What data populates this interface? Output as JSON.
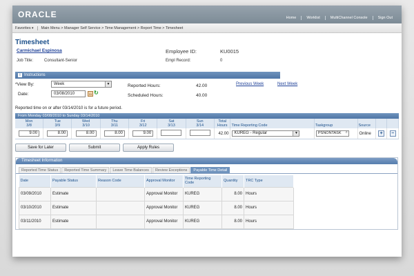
{
  "brand": "ORACLE",
  "top_links": [
    "Home",
    "Worklist",
    "MultiChannel Console",
    "Sign Out"
  ],
  "menu": {
    "favorites": "Favorites",
    "breadcrumb": "Main Menu > Manager Self Service > Time Management > Report Time > Timesheet"
  },
  "page": {
    "title": "Timesheet",
    "employee_name": "Carmichael Espinosa",
    "job_title_label": "Job Title:",
    "job_title": "Consultant-Senior",
    "employee_id_label": "Employee ID:",
    "employee_id": "KU0015",
    "empl_record_label": "Empl Record:",
    "empl_record": "0"
  },
  "instructions_label": "Instructions",
  "controls": {
    "view_by_label": "*View By:",
    "view_by_value": "Week",
    "date_label": "Date:",
    "date_value": "03/08/2010",
    "reported_hours_label": "Reported Hours:",
    "reported_hours": "42.00",
    "scheduled_hours_label": "Scheduled Hours:",
    "scheduled_hours": "40.00",
    "previous_week": "Previous Week",
    "next_week": "Next Week"
  },
  "future_message": "Reported time on or after 03/14/2010 is for a future period.",
  "grid": {
    "period": "From Monday 03/08/2010 to Sunday 03/14/2010",
    "days": [
      {
        "day": "Mon",
        "date": "3/8",
        "hours": "9.00"
      },
      {
        "day": "Tue",
        "date": "3/9",
        "hours": "8.00"
      },
      {
        "day": "Wed",
        "date": "3/10",
        "hours": "8.00"
      },
      {
        "day": "Thu",
        "date": "3/11",
        "hours": "8.00"
      },
      {
        "day": "Fri",
        "date": "3/12",
        "hours": "9.00"
      },
      {
        "day": "Sat",
        "date": "3/13",
        "hours": ""
      },
      {
        "day": "Sun",
        "date": "3/14",
        "hours": ""
      }
    ],
    "total_label": "Total",
    "hours_label": "Hours",
    "trc_label": "Time Reporting Code",
    "taskgroup_label": "Taskgroup",
    "source_label": "Source",
    "total": "42.00",
    "trc_value": "KUREG - Regular",
    "taskgroup_value": "PSNONTASK",
    "source_value": "Online",
    "add_symbol": "+",
    "remove_symbol": "−"
  },
  "buttons": {
    "save_later": "Save for Later",
    "submit": "Submit",
    "apply_rules": "Apply Rules"
  },
  "info_panel": {
    "title": "Timesheet Information",
    "tabs": [
      "Reported Time Status",
      "Reported Time Summary",
      "Leave Time Balances",
      "Review Exceptions",
      "Payable Time Detail"
    ],
    "active_tab": "Payable Time Detail",
    "columns": [
      "Date",
      "Payable Status",
      "Reason Code",
      "Approval Monitor",
      "Time Reporting Code",
      "Quantity",
      "TRC Type"
    ],
    "rows": [
      {
        "date": "03/09/2010",
        "status": "Estimate",
        "reason": "",
        "approval": "Approval Monitor",
        "trc": "KUREG",
        "quantity": "8.00",
        "trc_type": "Hours"
      },
      {
        "date": "03/10/2010",
        "status": "Estimate",
        "reason": "",
        "approval": "Approval Monitor",
        "trc": "KUREG",
        "quantity": "8.00",
        "trc_type": "Hours"
      },
      {
        "date": "03/11/2010",
        "status": "Estimate",
        "reason": "",
        "approval": "Approval Monitor",
        "trc": "KUREG",
        "quantity": "8.00",
        "trc_type": "Hours"
      }
    ]
  },
  "colors": {
    "accent": "#4f76a6",
    "link": "#1d3f97",
    "title": "#1b4f8a"
  }
}
